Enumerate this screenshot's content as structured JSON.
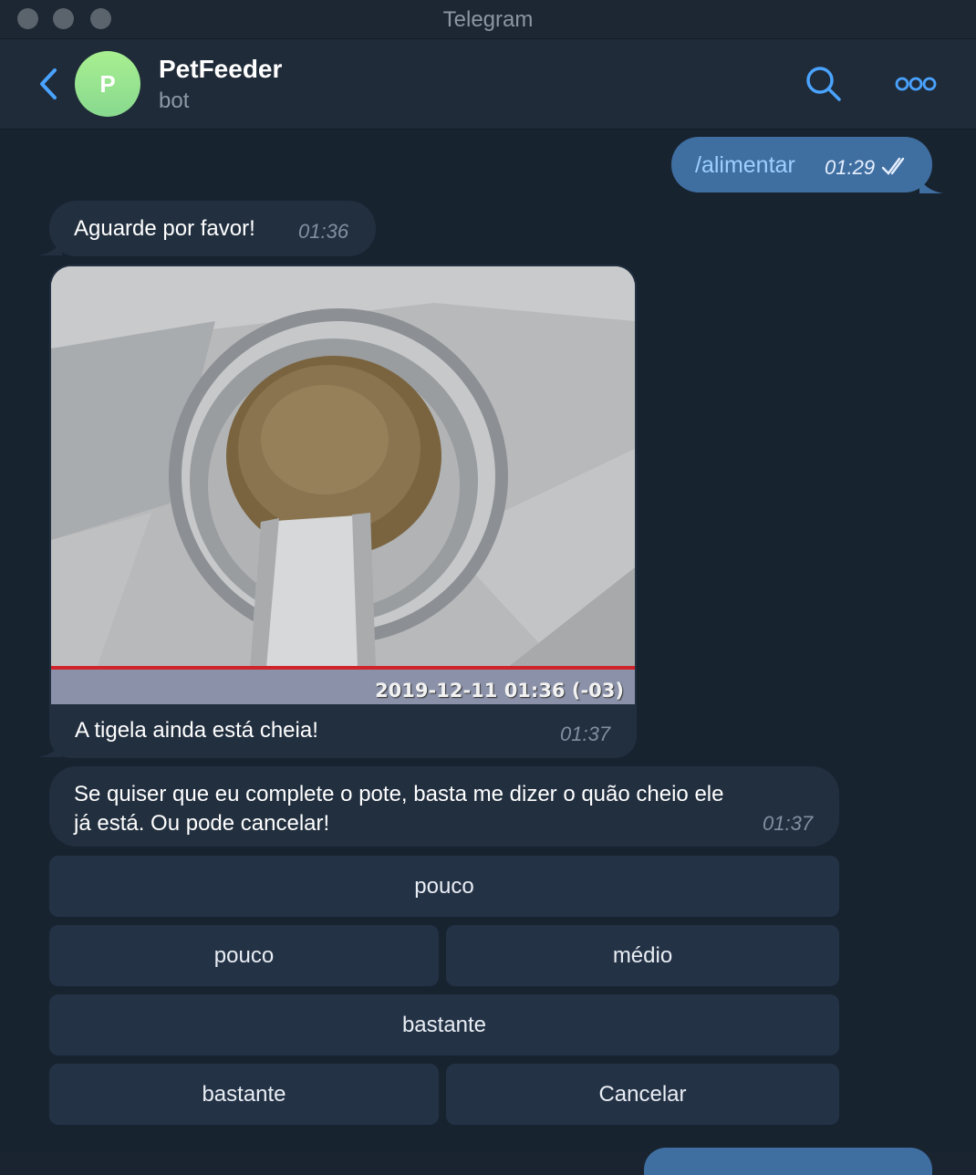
{
  "window": {
    "title": "Telegram"
  },
  "header": {
    "name": "PetFeeder",
    "status": "bot",
    "avatar_letter": "P"
  },
  "messages": {
    "outgoing": {
      "text": "/alimentar",
      "time": "01:29"
    },
    "incoming1": {
      "text": "Aguarde por favor!",
      "time": "01:36"
    },
    "photo": {
      "timestamp_overlay": "2019-12-11 01:36 (-03)",
      "caption": "A tigela ainda está cheia!",
      "time": "01:37"
    },
    "incoming2": {
      "line1": "Se quiser que eu complete o pote, basta me dizer o quão cheio ele",
      "line2": "já está. Ou pode cancelar!",
      "time": "01:37"
    }
  },
  "keyboard": {
    "row1": [
      "pouco"
    ],
    "row2": [
      "pouco",
      "médio"
    ],
    "row3": [
      "bastante"
    ],
    "row4": [
      "bastante",
      "Cancelar"
    ]
  },
  "colors": {
    "accent": "#4aa3ff",
    "bubble_in": "#222f3f",
    "bubble_out": "#3f6ea0",
    "background": "#182330"
  },
  "icons": {
    "back": "chevron-left-icon",
    "search": "search-icon",
    "more": "more-icon",
    "read": "double-check-icon"
  }
}
